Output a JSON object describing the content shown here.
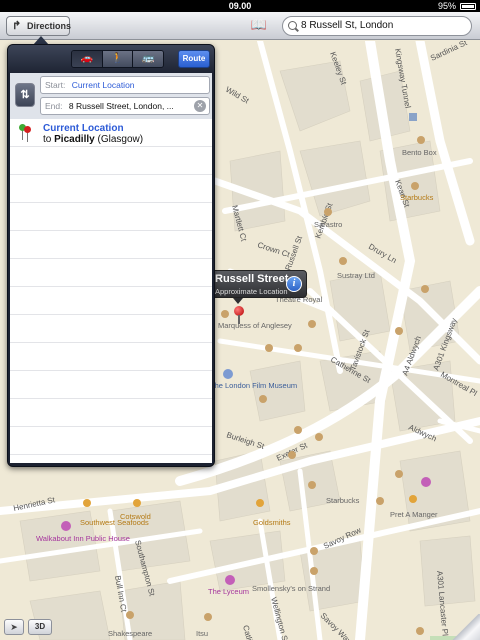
{
  "status_bar": {
    "time": "09.00",
    "battery": "95%"
  },
  "toolbar": {
    "directions_label": "Directions",
    "search_value": "8 Russell St, London"
  },
  "directions_panel": {
    "route_label": "Route",
    "start_label": "Start:",
    "start_value": "Current Location",
    "end_label": "End:",
    "end_value": "8 Russell Street, London, ...",
    "result": {
      "title": "Current Location",
      "to": "to",
      "destination": "Picadilly",
      "destination_extra": "(Glasgow)"
    }
  },
  "callout": {
    "title": "Russell Street",
    "subtitle": "Approximate Location"
  },
  "map_labels": {
    "streets": [
      "Kemble St",
      "Russell St",
      "Drury Ln",
      "Crown Ct",
      "Catherine St",
      "Tavistock St",
      "Exeter St",
      "Burleigh St",
      "Henrietta St",
      "Southampton St",
      "Savoy Row",
      "Savoy Way",
      "Aldwych",
      "A4 Aldwych",
      "Kingsway Tunnel",
      "A301 Kingsway",
      "A301 Lancaster Pl",
      "Montreal Pl",
      "Wild St",
      "Keeley St",
      "Sardinia St",
      "Kean St",
      "Martlett Ct",
      "Bull Inn Ct",
      "Wellington St",
      "Catling St"
    ],
    "pois": [
      "Bento Box",
      "Starbucks",
      "Sarastro",
      "Sustray Ltd",
      "Theatre Royal",
      "Marquess of Anglesey",
      "The London Film Museum",
      "Goldsmiths",
      "Starbucks",
      "Pret A Manger",
      "Smollensky's on Strand",
      "The Lyceum",
      "Southwest Seafoods",
      "Cotswold",
      "Walkabout Inn Public House",
      "Shakespeare",
      "Itsu"
    ]
  },
  "map_controls": {
    "three_d_label": "3D"
  },
  "colors": {
    "accent": "#2d5bd7",
    "pin": "#d42020",
    "popover": "#1c2231"
  }
}
